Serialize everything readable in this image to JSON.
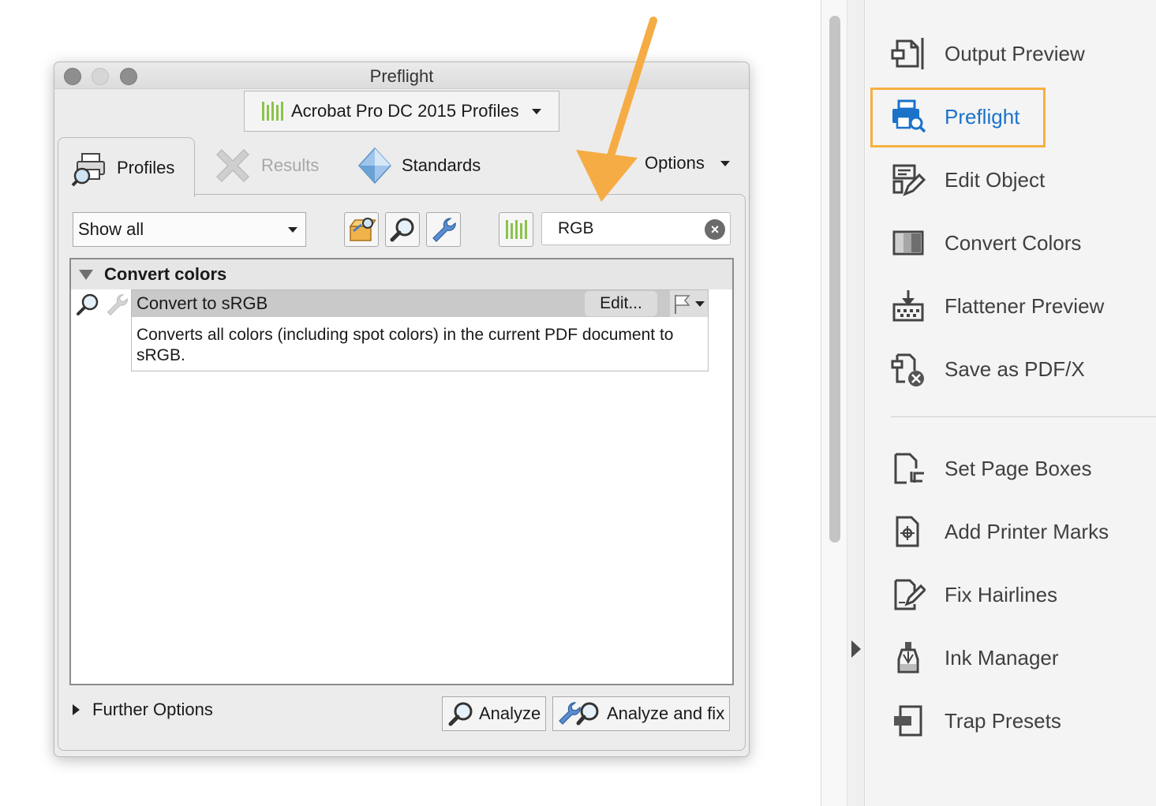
{
  "dialog": {
    "title": "Preflight",
    "profile_library": "Acrobat Pro DC 2015 Profiles",
    "tabs": [
      {
        "label": "Profiles",
        "state": "active"
      },
      {
        "label": "Results",
        "state": "disabled"
      },
      {
        "label": "Standards",
        "state": "normal"
      }
    ],
    "options_label": "Options",
    "filter": {
      "value": "Show all"
    },
    "search": {
      "value": "RGB"
    },
    "group": {
      "title": "Convert colors",
      "fixup": {
        "name": "Convert to sRGB",
        "edit_label": "Edit...",
        "description": "Converts all colors (including spot colors) in the current PDF document to sRGB."
      }
    },
    "further_options": "Further Options",
    "analyze_label": "Analyze",
    "analyze_fix_label": "Analyze and fix"
  },
  "annotation": {
    "color": "#F5AC45"
  },
  "tools_panel": {
    "highlight_color": "#F5B041",
    "items": [
      {
        "label": "Output Preview",
        "icon": "output-preview-icon"
      },
      {
        "label": "Preflight",
        "icon": "preflight-icon",
        "active": true
      },
      {
        "label": "Edit Object",
        "icon": "edit-object-icon"
      },
      {
        "label": "Convert Colors",
        "icon": "convert-colors-icon"
      },
      {
        "label": "Flattener Preview",
        "icon": "flattener-preview-icon"
      },
      {
        "label": "Save as PDF/X",
        "icon": "save-pdfx-icon"
      },
      {
        "label": "Set Page Boxes",
        "icon": "set-page-boxes-icon"
      },
      {
        "label": "Add Printer Marks",
        "icon": "add-printer-marks-icon"
      },
      {
        "label": "Fix Hairlines",
        "icon": "fix-hairlines-icon"
      },
      {
        "label": "Ink Manager",
        "icon": "ink-manager-icon"
      },
      {
        "label": "Trap Presets",
        "icon": "trap-presets-icon"
      }
    ]
  }
}
